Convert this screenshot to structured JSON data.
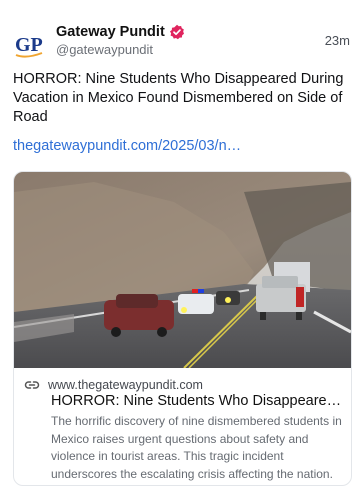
{
  "post": {
    "author": {
      "display_name": "Gateway Pundit",
      "handle": "@gatewaypundit",
      "avatar_text": "GP",
      "verified": true
    },
    "time": "23m",
    "text": "HORROR: Nine Students Who Disappeared During Vacation in Mexico Found Dismembered on Side of Road",
    "link_text": "thegatewaypundit.com/2025/03/n…",
    "card": {
      "domain": "www.thegatewaypundit.com",
      "title": "HORROR: Nine Students Who Disappeared Dur…",
      "description": "The horrific discovery of nine dismembered students in Mexico raises urgent questions about safety and violence in tourist areas. This tragic incident underscores the escalating crisis affecting the nation.",
      "link_icon": "link-icon"
    }
  },
  "colors": {
    "link": "#2f6fd6",
    "verified_badge": "#e0245e",
    "avatar_primary": "#1b3a8a",
    "avatar_accent": "#f0a531"
  }
}
